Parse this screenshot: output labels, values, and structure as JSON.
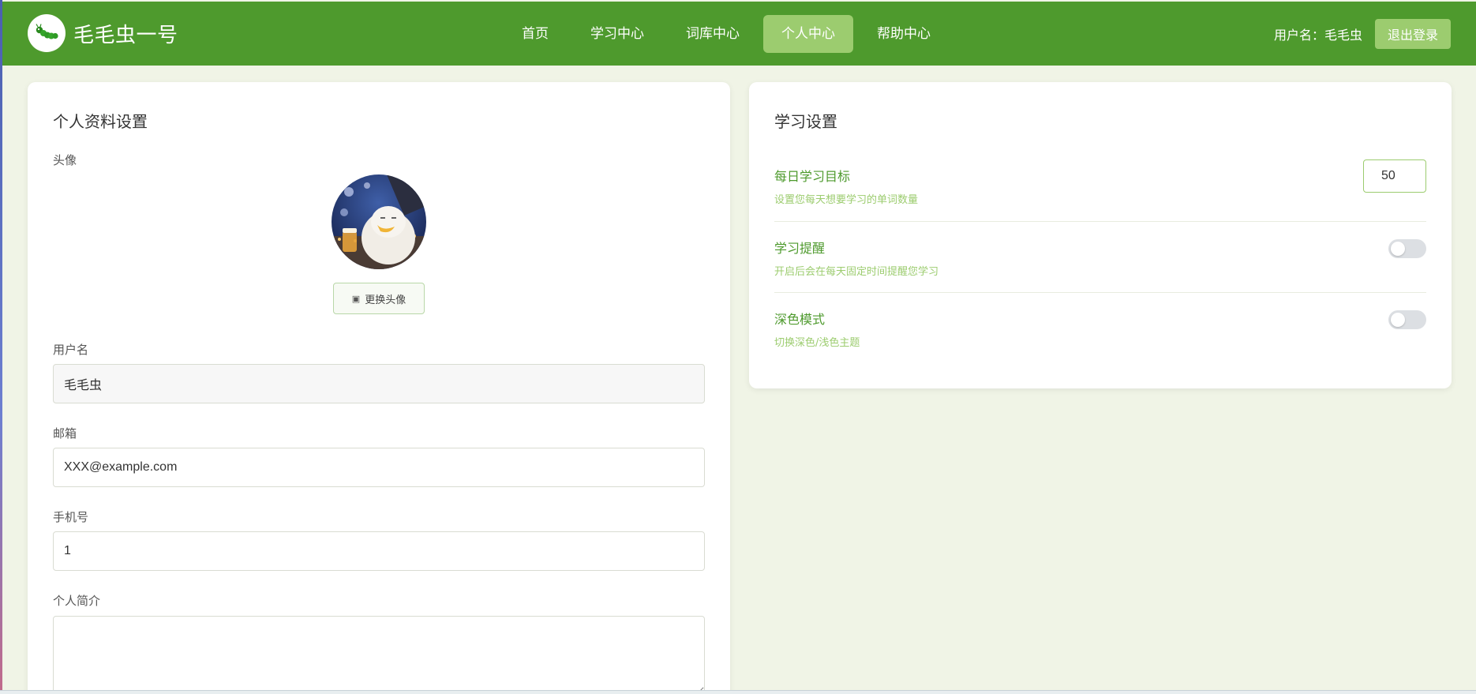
{
  "app": {
    "brand_name": "毛毛虫一号",
    "logo_icon": "caterpillar-icon"
  },
  "nav": {
    "items": [
      {
        "label": "首页"
      },
      {
        "label": "学习中心"
      },
      {
        "label": "词库中心"
      },
      {
        "label": "个人中心",
        "active": true
      },
      {
        "label": "帮助中心"
      }
    ]
  },
  "user": {
    "label": "用户名：毛毛虫",
    "logout_label": "退出登录"
  },
  "profile": {
    "title": "个人资料设置",
    "avatar_label": "头像",
    "change_avatar_icon": "camera-icon",
    "change_avatar_label": "更换头像",
    "username_label": "用户名",
    "username_value": "毛毛虫",
    "email_label": "邮箱",
    "email_value": "XXX@example.com",
    "phone_label": "手机号",
    "phone_value": "1",
    "bio_label": "个人简介",
    "bio_value": ""
  },
  "study": {
    "title": "学习设置",
    "daily_goal": {
      "title": "每日学习目标",
      "desc": "设置您每天想要学习的单词数量",
      "value": "50"
    },
    "reminder": {
      "title": "学习提醒",
      "desc": "开启后会在每天固定时间提醒您学习",
      "enabled": false
    },
    "dark_mode": {
      "title": "深色模式",
      "desc": "切换深色/浅色主题",
      "enabled": false
    }
  },
  "colors": {
    "primary": "#4e9a2d",
    "accent": "#9ccc6f",
    "background": "#f0f4e6"
  }
}
